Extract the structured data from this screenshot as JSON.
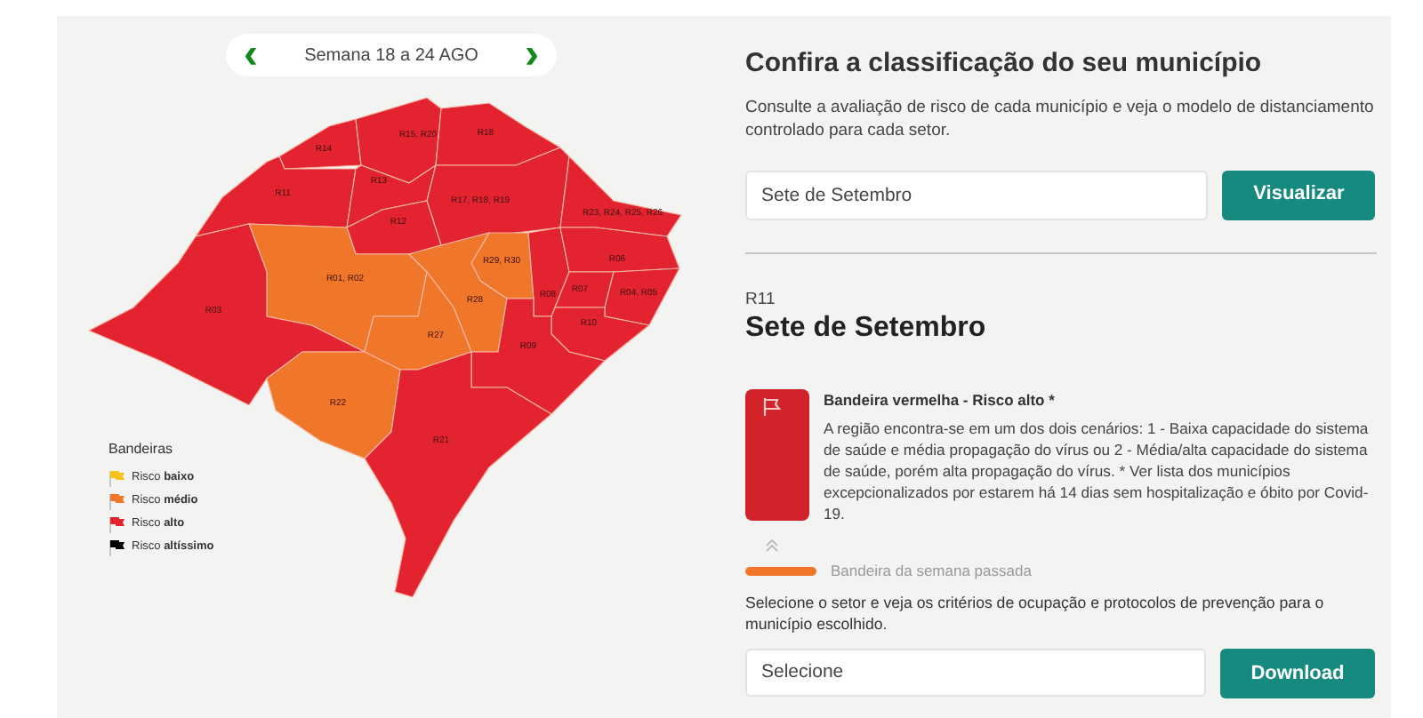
{
  "week_nav": {
    "prev": "‹",
    "label": "Semana 18 a 24 AGO",
    "next": "›"
  },
  "map": {
    "regions": [
      {
        "label": "R14",
        "color": "#e3232f"
      },
      {
        "label": "R15, R20",
        "color": "#e3232f"
      },
      {
        "label": "R18",
        "color": "#e3232f"
      },
      {
        "label": "R11",
        "color": "#e3232f"
      },
      {
        "label": "R13",
        "color": "#e3232f"
      },
      {
        "label": "R17, R18, R19",
        "color": "#e3232f"
      },
      {
        "label": "R23, R24, R25, R26",
        "color": "#e3232f"
      },
      {
        "label": "R12",
        "color": "#e3232f"
      },
      {
        "label": "R01, R02",
        "color": "#f0762a"
      },
      {
        "label": "R03",
        "color": "#e3232f"
      },
      {
        "label": "R29, R30",
        "color": "#f0762a"
      },
      {
        "label": "R28",
        "color": "#f0762a"
      },
      {
        "label": "R27",
        "color": "#f0762a"
      },
      {
        "label": "R08",
        "color": "#e3232f"
      },
      {
        "label": "R06",
        "color": "#e3232f"
      },
      {
        "label": "R07",
        "color": "#e3232f"
      },
      {
        "label": "R04, R05",
        "color": "#e3232f"
      },
      {
        "label": "R10",
        "color": "#e3232f"
      },
      {
        "label": "R09",
        "color": "#e3232f"
      },
      {
        "label": "R22",
        "color": "#f0762a"
      },
      {
        "label": "R21",
        "color": "#e3232f"
      }
    ]
  },
  "legend": {
    "title": "Bandeiras",
    "items": [
      {
        "label": "Risco **baixo**",
        "color": "#f7c31a"
      },
      {
        "label": "Risco **médio**",
        "color": "#f0762a"
      },
      {
        "label": "Risco **alto**",
        "color": "#e3232f"
      },
      {
        "label": "Risco **altíssimo**",
        "color": "#000000"
      }
    ]
  },
  "search": {
    "title": "Confira a classificação do seu município",
    "intro": "Consulte a avaliação de risco de cada município e veja o modelo de distanciamento controlado para cada setor.",
    "value": "Sete de Setembro",
    "button": "Visualizar"
  },
  "result": {
    "region": "R11",
    "municipality": "Sete de Setembro",
    "flag": {
      "color": "#d2232a",
      "title": "Bandeira vermelha - Risco alto *",
      "description": "A região encontra-se em um dos dois cenários: 1 - Baixa capacidade do sistema de saúde e média propagação do vírus ou 2 - Média/alta capacidade do sistema de saúde, porém alta propagação do vírus.  * Ver lista dos municípios excepcionalizados por estarem há 14 dias sem hospitalização e óbito por Covid-19."
    },
    "previous_flag": {
      "color": "#f0762a",
      "label": "Bandeira da semana passada"
    },
    "sector_text": "Selecione o setor e veja os critérios de ocupação e protocolos de prevenção para o município escolhido.",
    "select": "Selecione",
    "download": "Download"
  }
}
